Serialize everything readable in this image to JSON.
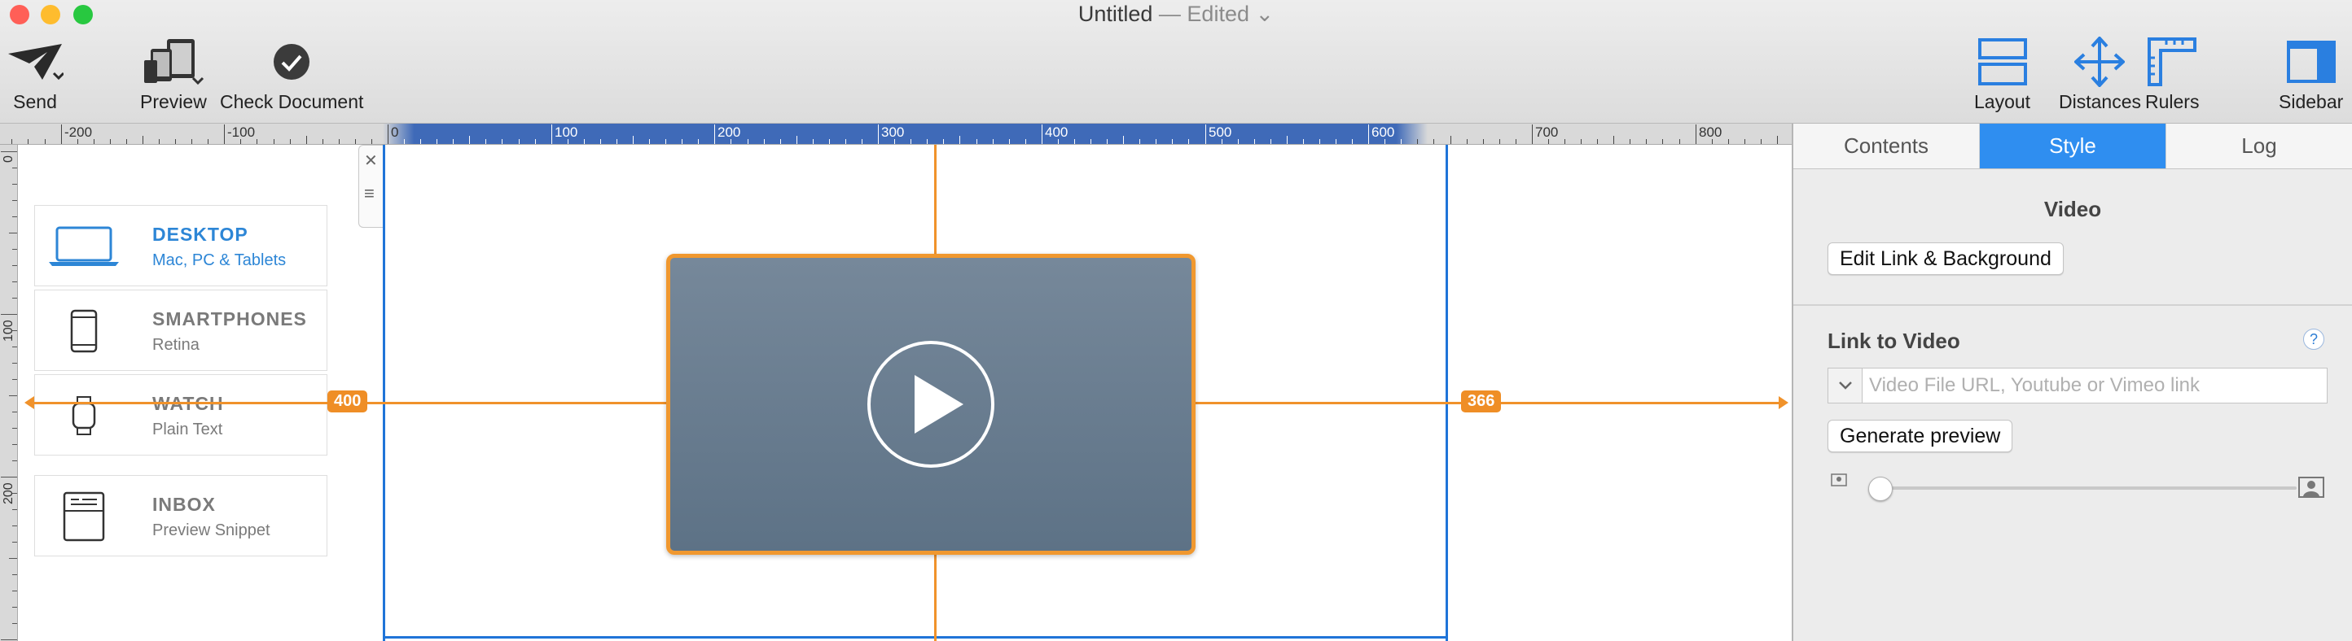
{
  "window": {
    "title": "Untitled",
    "title_status": " — Edited",
    "traffic_colors": [
      "#ff5f57",
      "#febc2e",
      "#28c840"
    ]
  },
  "toolbar": {
    "send_label": "Send",
    "preview_label": "Preview",
    "check_label": "Check Document",
    "layout_label": "Layout",
    "distances_label": "Distances",
    "rulers_label": "Rulers",
    "sidebar_label": "Sidebar"
  },
  "ruler": {
    "labels": [
      "-200",
      "-100",
      "0",
      "100",
      "200",
      "300",
      "400",
      "500",
      "600",
      "700",
      "800"
    ],
    "vertical_labels": [
      "0",
      "100",
      "200"
    ]
  },
  "devices": [
    {
      "name": "DESKTOP",
      "sub": "Mac, PC & Tablets",
      "icon": "laptop-icon",
      "active": true
    },
    {
      "name": "SMARTPHONES",
      "sub": "Retina",
      "icon": "smartphone-icon",
      "active": false
    },
    {
      "name": "WATCH",
      "sub": "Plain Text",
      "icon": "watch-icon",
      "active": false
    },
    {
      "name": "INBOX",
      "sub": "Preview Snippet",
      "icon": "inbox-icon",
      "active": false
    }
  ],
  "canvas": {
    "distance_left": "400",
    "distance_right": "366",
    "accent_color": "#f0922b",
    "viewport_color": "#1f74d8"
  },
  "sidebar": {
    "tabs": [
      "Contents",
      "Style",
      "Log"
    ],
    "active_tab": "Style",
    "section_title": "Video",
    "edit_button": "Edit Link & Background",
    "link_label": "Link to Video",
    "help_label": "?",
    "url_placeholder": "Video File URL, Youtube or Vimeo link",
    "url_value": "",
    "generate_button": "Generate preview",
    "size_slider": 0
  }
}
